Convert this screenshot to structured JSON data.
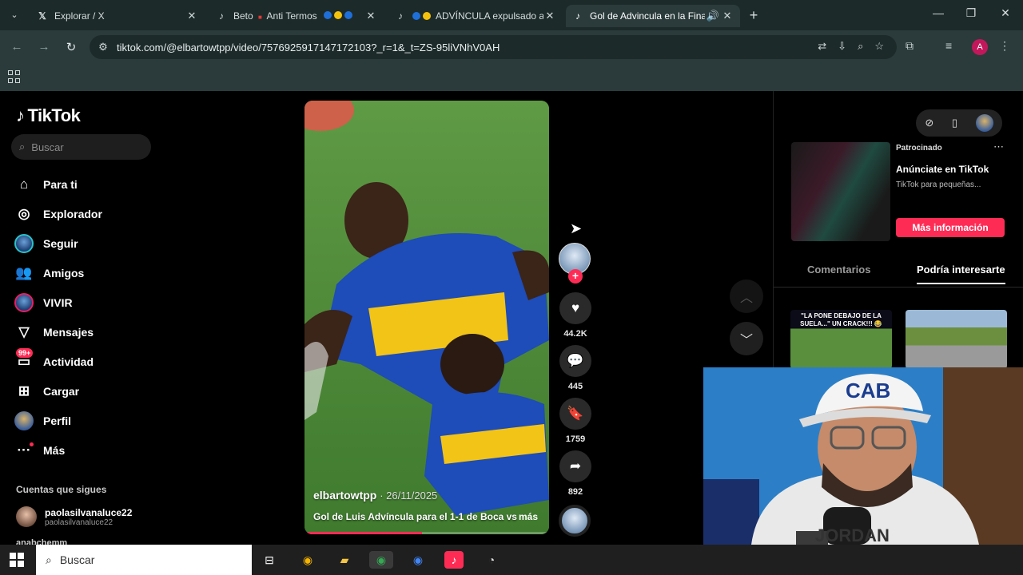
{
  "browser": {
    "tabs": [
      {
        "title": "Explorar / X",
        "favicon": "x-logo-icon"
      },
      {
        "title": "Beto",
        "title2": "Anti Termos",
        "favicon": "tiktok-icon"
      },
      {
        "title": "ADVÍNCULA expulsado a",
        "favicon": "tiktok-icon"
      },
      {
        "title": "Gol de Advincula en la Final",
        "favicon": "tiktok-icon",
        "active": true
      }
    ],
    "url": "tiktok.com/@elbartowtpp/video/7576925917147172103?_r=1&_t=ZS-95liVNhV0AH",
    "profile_initial": "A"
  },
  "tiktok": {
    "logo": "TikTok",
    "search_placeholder": "Buscar",
    "nav": [
      {
        "label": "Para ti",
        "icon": "home-icon"
      },
      {
        "label": "Explorador",
        "icon": "compass-icon"
      },
      {
        "label": "Seguir",
        "icon": "avatar"
      },
      {
        "label": "Amigos",
        "icon": "friends-icon"
      },
      {
        "label": "VIVIR",
        "icon": "live-avatar"
      },
      {
        "label": "Mensajes",
        "icon": "send-icon"
      },
      {
        "label": "Actividad",
        "icon": "inbox-icon",
        "badge": "99+"
      },
      {
        "label": "Cargar",
        "icon": "upload-icon"
      },
      {
        "label": "Perfil",
        "icon": "profile-avatar"
      },
      {
        "label": "Más",
        "icon": "more-icon"
      }
    ],
    "following_title": "Cuentas que sigues",
    "following": [
      {
        "name": "paolasilvanaluce22",
        "handle": "paolasilvanaluce22"
      },
      {
        "name": "anabchemm"
      }
    ]
  },
  "video": {
    "username": "elbartowtpp",
    "date": "· 26/11/2025",
    "caption": "Gol de Luis Advíncula para el 1-1 de Boca vs",
    "more": "más",
    "progress": 0.48,
    "likes": "44.2K",
    "comments": "445",
    "saves": "1759",
    "shares": "892"
  },
  "right_panel": {
    "ad_sponsored": "Patrocinado",
    "ad_title": "Anúnciate en TikTok",
    "ad_subtitle": "TikTok para pequeñas...",
    "ad_button": "Más información",
    "tab_comments": "Comentarios",
    "tab_interest": "Podría interesarte",
    "rec1_text": "\"LA PONE DEBAJO DE LA SUELA...\" UN CRACK!!! 😂"
  },
  "webcam": {
    "cap_text": "CAB",
    "shirt_text": "JORDAN"
  },
  "taskbar": {
    "search_placeholder": "Buscar"
  },
  "colors": {
    "accent": "#fe2c55",
    "chrome_dark": "#1d2a2a",
    "chrome_mid": "#2b3b3b"
  }
}
